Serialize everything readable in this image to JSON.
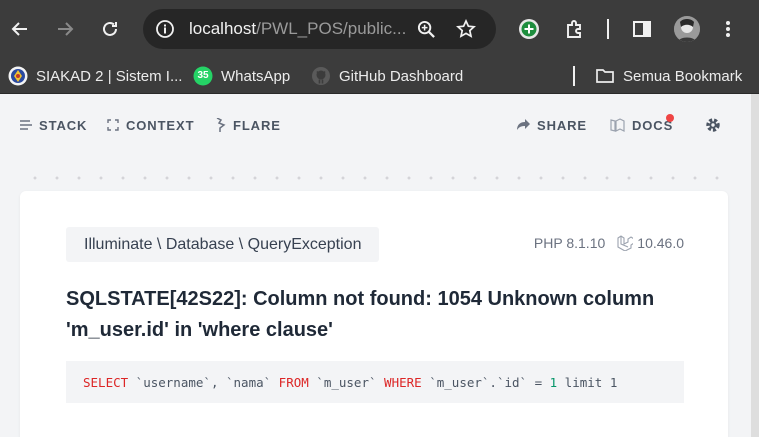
{
  "browser": {
    "url_host": "localhost",
    "url_path": "/PWL_POS/public...",
    "icons": [
      "back-icon",
      "forward-icon",
      "reload-icon",
      "site-info-icon",
      "zoom-icon",
      "star-icon",
      "extension-plus-icon",
      "puzzle-icon",
      "side-panel-icon",
      "avatar"
    ]
  },
  "bookmarks": {
    "items": [
      {
        "label": "SIAKAD 2 | Sistem I...",
        "icon": "siakad-logo-icon"
      },
      {
        "label": "WhatsApp",
        "icon": "whatsapp-icon",
        "badge": "35"
      },
      {
        "label": "GitHub Dashboard",
        "icon": "github-icon"
      }
    ],
    "all_bookmarks": "Semua Bookmark"
  },
  "ignition_nav": {
    "stack": "STACK",
    "context": "CONTEXT",
    "flare": "FLARE",
    "share": "SHARE",
    "docs": "DOCS"
  },
  "error": {
    "exception_class": "Illuminate \\ Database \\ QueryException",
    "php_version": "PHP 8.1.10",
    "laravel_version": "10.46.0",
    "message": "SQLSTATE[42S22]: Column not found: 1054 Unknown column 'm_user.id' in 'where clause'",
    "sql": {
      "kw_select": "SELECT",
      "cols": " `username`, `nama` ",
      "kw_from": "FROM",
      "table": " `m_user` ",
      "kw_where": "WHERE",
      "cond": " `m_user`.`id` = ",
      "num": "1",
      "rest": " limit 1"
    }
  },
  "colors": {
    "browser_chrome": "#3c3c3c",
    "omnibox": "#262626",
    "page_bg": "#f3f4f6",
    "sql_keyword": "#dc2626",
    "sql_number": "#059669",
    "notification_dot": "#ef4444"
  }
}
